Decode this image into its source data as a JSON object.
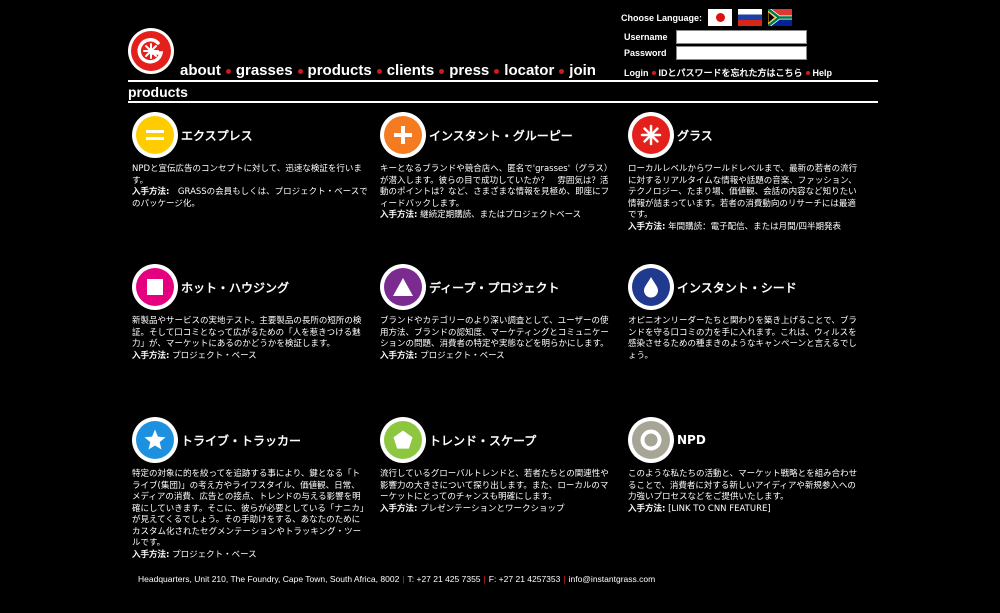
{
  "language": {
    "label": "Choose Language:",
    "flags": [
      "japan-flag",
      "russia-flag",
      "south-africa-flag"
    ]
  },
  "login": {
    "username_label": "Username",
    "username_value": "",
    "password_label": "Password",
    "password_value": "",
    "login_link": "Login",
    "forgot_link": "IDとパスワードを忘れた方はこちら",
    "help_link": "Help"
  },
  "nav": [
    "about",
    "grasses",
    "products",
    "clients",
    "press",
    "locator",
    "join"
  ],
  "page_title": "products",
  "how_label": "入手方法:",
  "products": [
    {
      "title": "エクスプレス",
      "icon": "equals-icon",
      "color": "#ffcc00",
      "desc": "NPDと宣伝広告のコンセプトに対して、迅速な検証を行います。",
      "how": "GRASSの会員もしくは、プロジェクト・ベースでのパッケージ化。"
    },
    {
      "title": "インスタント・グルーピー",
      "icon": "plus-icon",
      "color": "#f47b20",
      "desc": "キーとなるブランドや競合店へ、匿名で'grasses'（グラス）が潜入します。彼らの目で成功していたか？　雰囲気は？活動のポイントは？など、さまざまな情報を見極め、即座にフィードバックします。",
      "how": "継続定期購読、またはプロジェクトベース"
    },
    {
      "title": "グラス",
      "icon": "asterisk-icon",
      "color": "#e3201b",
      "desc": "ローカルレベルからワールドレベルまで、最新の若者の流行に対するリアルタイムな情報や話題の音楽、ファッション、テクノロジー、たまり場、価値観、会話の内容など知りたい情報が詰まっています。若者の消費動向のリサーチには最適です。",
      "how": "年間購読：電子配信、または月間/四半期発表"
    },
    {
      "title": "ホット・ハウジング",
      "icon": "square-icon",
      "color": "#e4007f",
      "desc": "新製品やサービスの実地テスト。主要製品の長所の短所の検証。そして口コミとなって広がるための「人を惹きつける魅力」が、マーケットにあるのかどうかを検証します。",
      "how": "プロジェクト・ベース"
    },
    {
      "title": "ディープ・プロジェクト",
      "icon": "triangle-icon",
      "color": "#7b2a8f",
      "desc": "ブランドやカテゴリーのより深い調査として、ユーザーの使用方法、ブランドの認知度、マーケティングとコミュニケーションの問題、消費者の特定や実態などを明らかにします。",
      "how": "プロジェクト・ベース"
    },
    {
      "title": "インスタント・シード",
      "icon": "drop-icon",
      "color": "#1f3a8f",
      "desc": "オピニオンリーダーたちと関わりを築き上げることで、ブランドを守る口コミの力を手に入れます。これは、ウィルスを感染させるための種まきのようなキャンペーンと言えるでしょう。",
      "how": ""
    },
    {
      "title": "トライブ・トラッカー",
      "icon": "star-icon",
      "color": "#1e90e0",
      "desc": "特定の対象に的を絞ってを追跡する事により、鍵となる「トライブ(集団)」の考え方やライフスタイル、価値観、日常、メディアの消費、広告との接点、トレンドの与える影響を明確にしていきます。そこに、彼らが必要としている「ナニカ」が見えてくるでしょう。その手助けをする、あなたのためにカスタム化されたセグメンテーションやトラッキング・ツールです。",
      "how": "プロジェクト・ベース"
    },
    {
      "title": "トレンド・スケープ",
      "icon": "pentagon-icon",
      "color": "#8dc63f",
      "desc": "流行しているグローバルトレンドと、若者たちとの関連性や影響力の大きさについて探り出します。また、ローカルのマーケットにとってのチャンスも明確にします。",
      "how": "プレゼンテーションとワークショップ"
    },
    {
      "title": "NPD",
      "icon": "circle-icon",
      "color": "#a7a596",
      "desc": "このような私たちの活動と、マーケット戦略とを組み合わせることで、消費者に対する新しいアイディアや新規参入への力強いプロセスなどをご提供いたします。",
      "how": "[LINK TO CNN FEATURE]"
    }
  ],
  "footer": {
    "address": "Headquarters, Unit 210, The Foundry, Cape Town, South Africa, 8002",
    "tel": "T: +27 21 425 7355",
    "fax": "F: +27 21 4257353",
    "email": "info@instantgrass.com"
  }
}
